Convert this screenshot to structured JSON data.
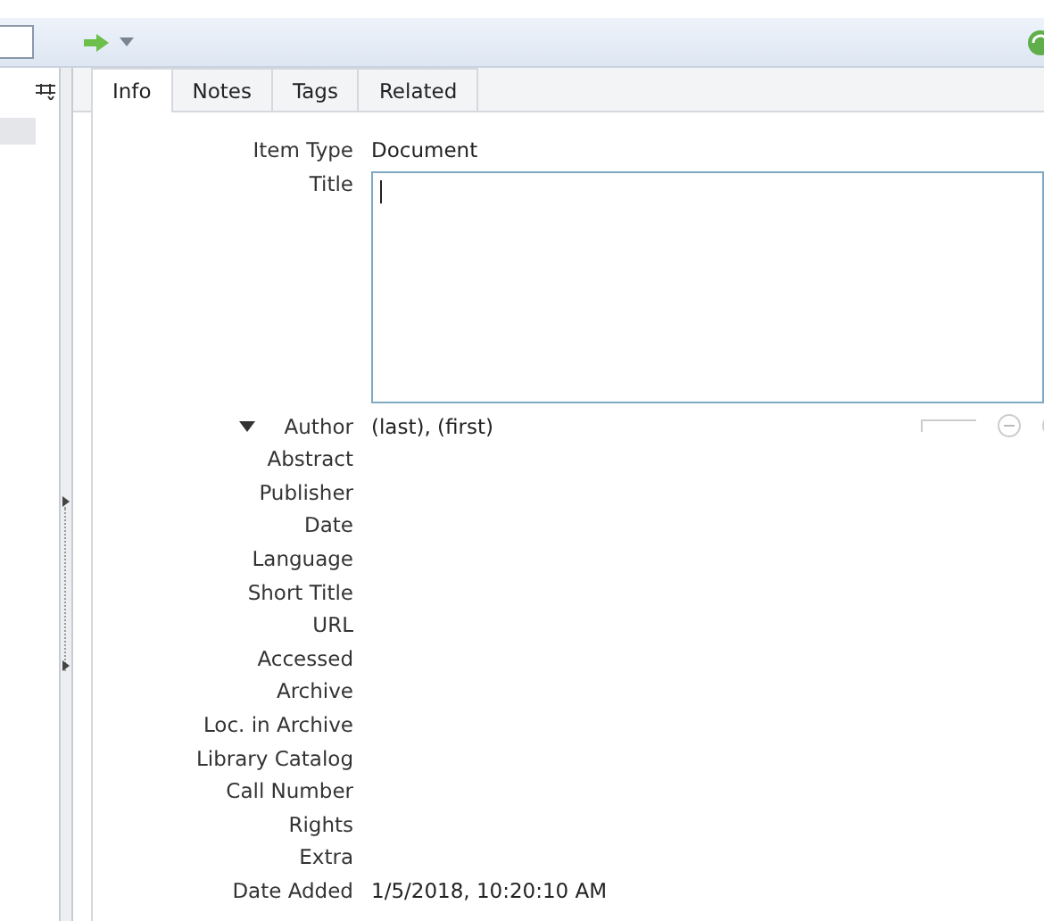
{
  "tabs": [
    {
      "label": "Info",
      "selected": true
    },
    {
      "label": "Notes",
      "selected": false
    },
    {
      "label": "Tags",
      "selected": false
    },
    {
      "label": "Related",
      "selected": false
    }
  ],
  "item_type": {
    "label": "Item Type",
    "value": "Document"
  },
  "title_field": {
    "label": "Title"
  },
  "author": {
    "label": "Author",
    "expanded": true,
    "value": "(last), (first)"
  },
  "fields": [
    {
      "label": "Abstract"
    },
    {
      "label": "Publisher"
    },
    {
      "label": "Date"
    },
    {
      "label": "Language"
    },
    {
      "label": "Short Title"
    },
    {
      "label": "URL"
    },
    {
      "label": "Accessed"
    },
    {
      "label": "Archive"
    },
    {
      "label": "Loc. in Archive"
    },
    {
      "label": "Library Catalog"
    },
    {
      "label": "Call Number"
    },
    {
      "label": "Rights"
    },
    {
      "label": "Extra"
    },
    {
      "label": "Date Added",
      "value": "1/5/2018, 10:20:10 AM"
    }
  ]
}
